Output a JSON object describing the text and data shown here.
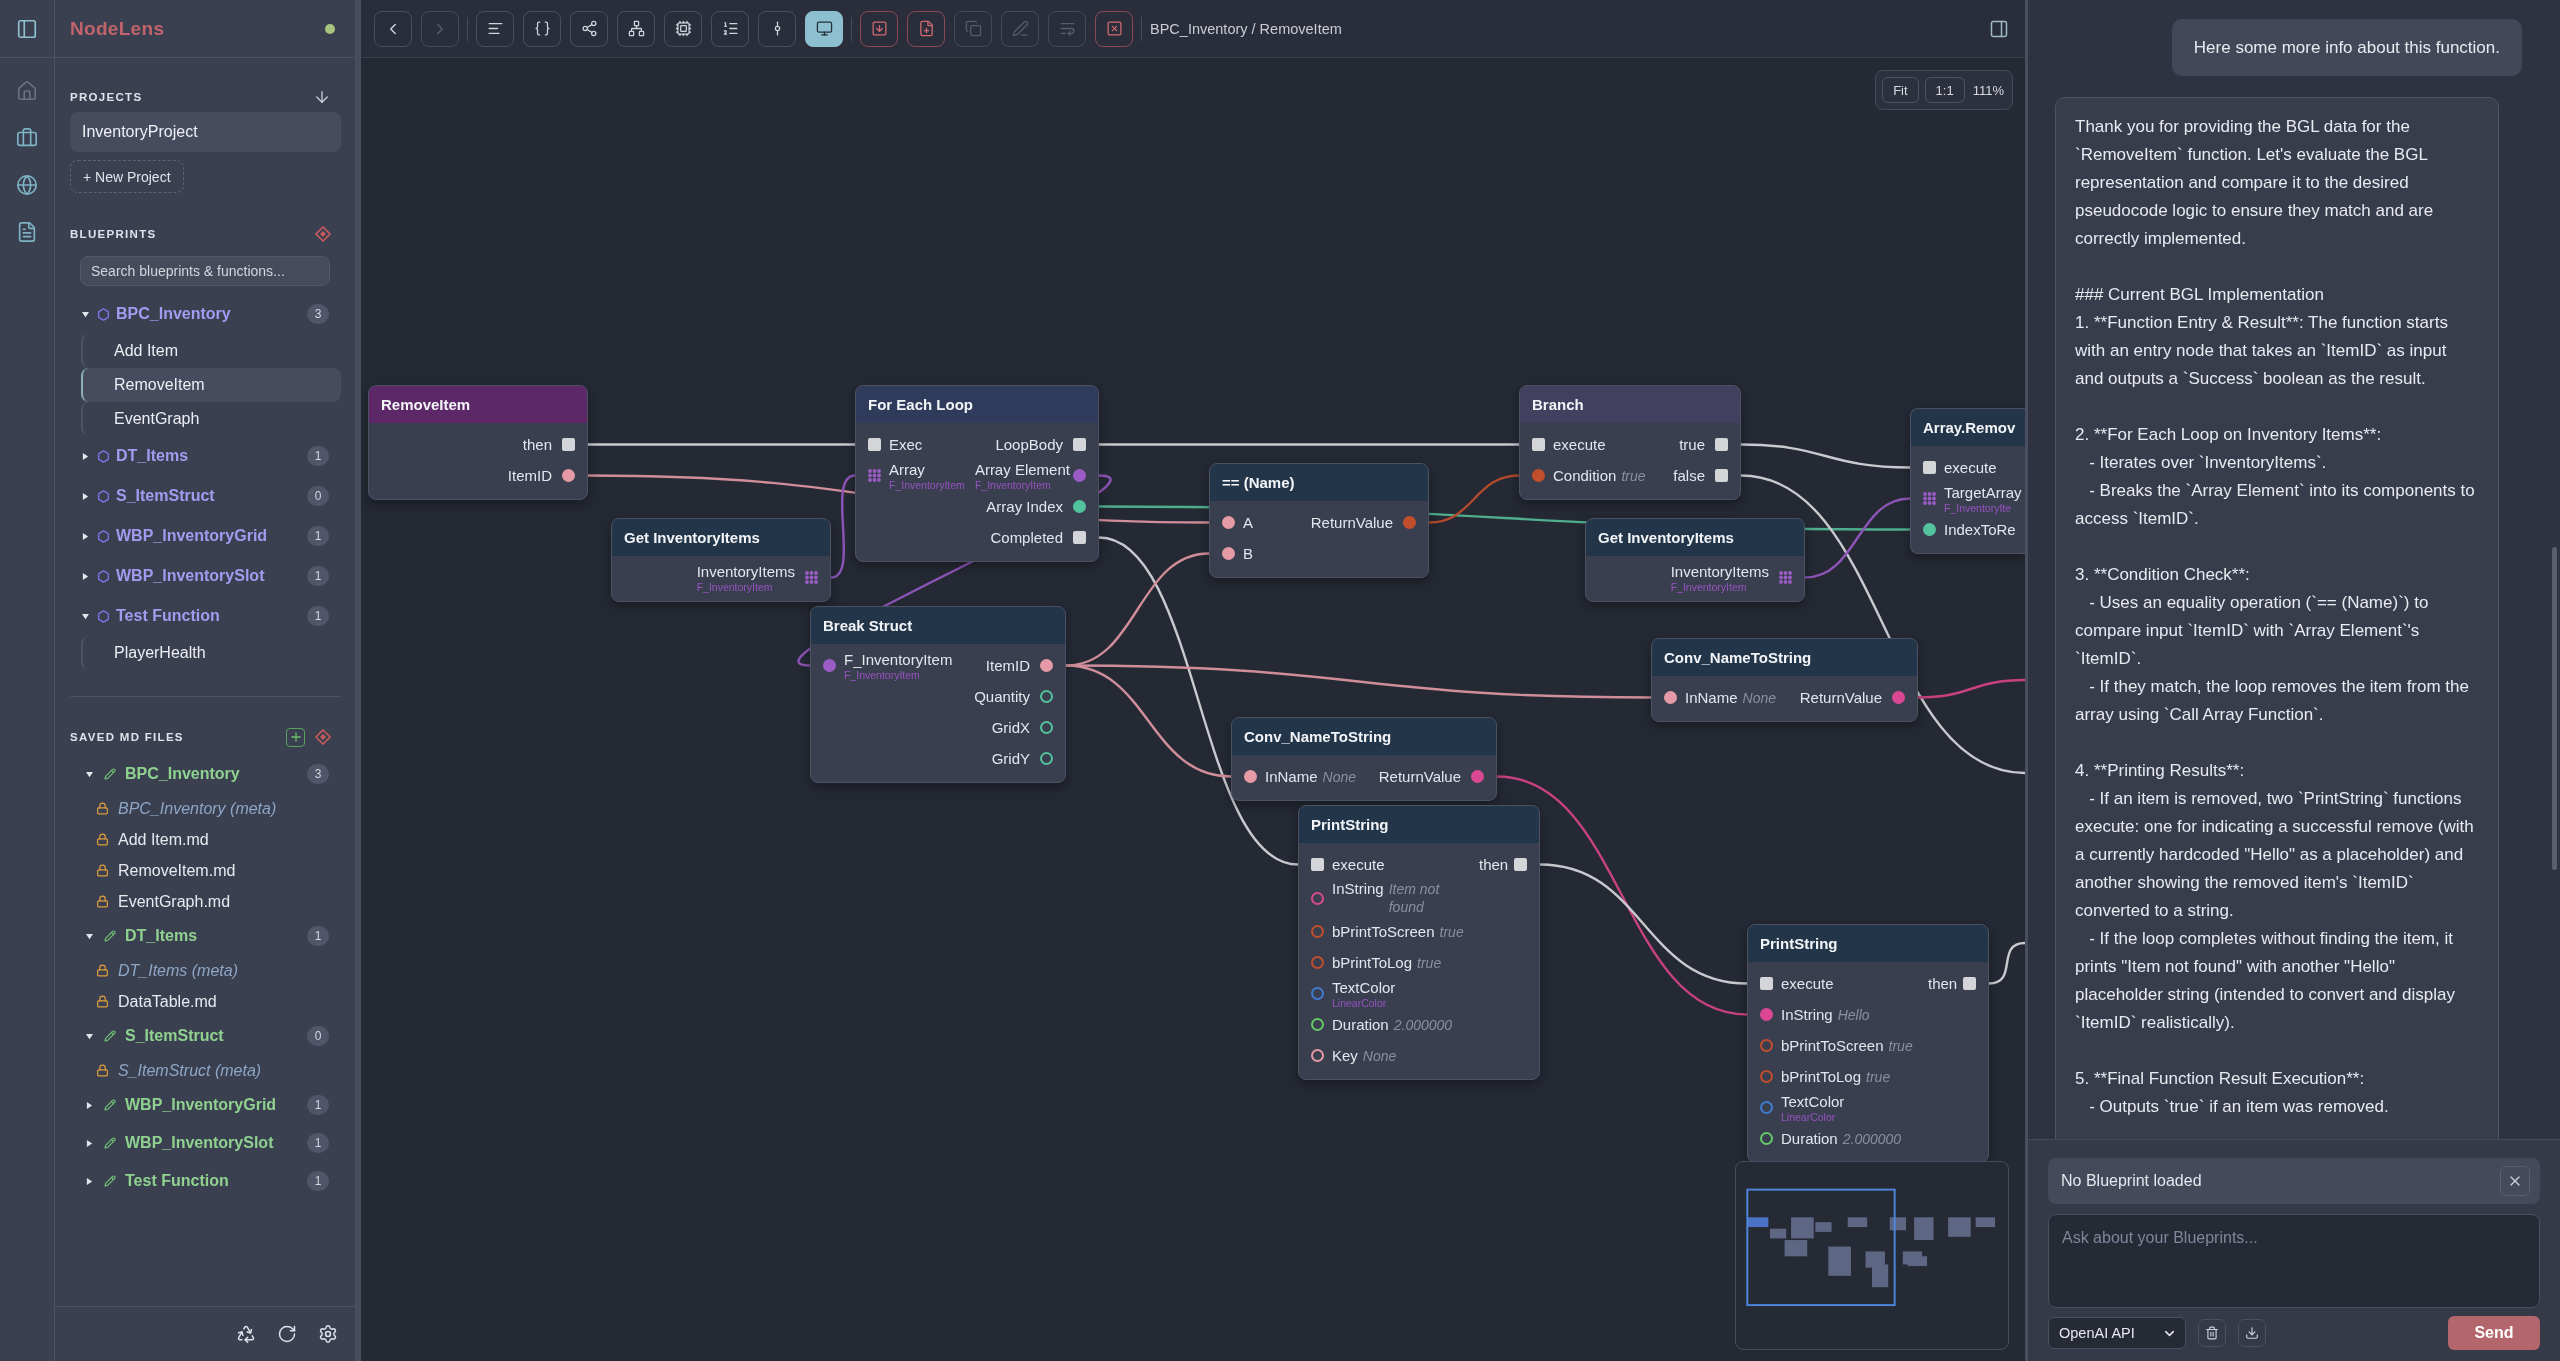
{
  "rail": {
    "items": [
      {
        "disabled": true
      },
      {
        "disabled": false
      },
      {
        "disabled": false
      },
      {
        "disabled": false
      }
    ]
  },
  "sidebar": {
    "brand": "NodeLens",
    "projects": {
      "title": "PROJECTS",
      "items": [
        {
          "label": "InventoryProject",
          "selected": true
        }
      ],
      "new_button": "+ New Project"
    },
    "blueprints": {
      "title": "BLUEPRINTS",
      "search": {
        "placeholder": "Search blueprints & functions..."
      },
      "items": [
        {
          "label": "BPC_Inventory",
          "count": "3",
          "expanded": true,
          "children": [
            {
              "label": "Add Item",
              "selected": false
            },
            {
              "label": "RemoveItem",
              "selected": true
            },
            {
              "label": "EventGraph",
              "selected": false
            }
          ]
        },
        {
          "label": "DT_Items",
          "count": "1",
          "expanded": false
        },
        {
          "label": "S_ItemStruct",
          "count": "0",
          "expanded": false
        },
        {
          "label": "WBP_InventoryGrid",
          "count": "1",
          "expanded": false
        },
        {
          "label": "WBP_InventorySlot",
          "count": "1",
          "expanded": false
        },
        {
          "label": "Test Function",
          "count": "1",
          "expanded": true,
          "children": [
            {
              "label": "PlayerHealth",
              "selected": false
            }
          ]
        }
      ]
    },
    "saved_files": {
      "title": "SAVED MD FILES",
      "groups": [
        {
          "label": "BPC_Inventory",
          "count": "3",
          "expanded": true,
          "children": [
            {
              "label": "BPC_Inventory (meta)",
              "kind": "meta"
            },
            {
              "label": "Add Item.md",
              "kind": "file"
            },
            {
              "label": "RemoveItem.md",
              "kind": "file"
            },
            {
              "label": "EventGraph.md",
              "kind": "file"
            }
          ]
        },
        {
          "label": "DT_Items",
          "count": "1",
          "expanded": true,
          "children": [
            {
              "label": "DT_Items (meta)",
              "kind": "meta"
            },
            {
              "label": "DataTable.md",
              "kind": "file"
            }
          ]
        },
        {
          "label": "S_ItemStruct",
          "count": "0",
          "expanded": true,
          "children": [
            {
              "label": "S_ItemStruct (meta)",
              "kind": "meta"
            }
          ]
        },
        {
          "label": "WBP_InventoryGrid",
          "count": "1",
          "expanded": false
        },
        {
          "label": "WBP_InventorySlot",
          "count": "1",
          "expanded": false
        },
        {
          "label": "Test Function",
          "count": "1",
          "expanded": false
        }
      ]
    }
  },
  "toolbar": {
    "nav": [
      {
        "disabled": false
      },
      {
        "disabled": true
      }
    ],
    "views": [
      {
        "selected": false
      },
      {
        "selected": false
      },
      {
        "selected": false
      },
      {
        "selected": false
      },
      {
        "selected": false
      },
      {
        "selected": false
      },
      {
        "selected": false
      },
      {
        "selected": true
      }
    ],
    "actions": [
      {
        "disabled": false
      },
      {
        "disabled": false
      },
      {
        "disabled": true
      },
      {
        "disabled": true
      },
      {
        "disabled": true
      },
      {
        "disabled": false
      }
    ],
    "breadcrumb": "BPC_Inventory / RemoveItem"
  },
  "canvas": {
    "zoom_controls": {
      "fit": "Fit",
      "actual_size": "1:1",
      "zoom": "111%"
    },
    "nodes": [
      {
        "title": "RemoveItem",
        "kind": "event",
        "outputs": [
          {
            "label": "then",
            "kind": "exec",
            "connected": true
          },
          {
            "label": "ItemID",
            "kind": "name",
            "connected": true
          }
        ]
      },
      {
        "title": "For Each Loop",
        "kind": "loop",
        "inputs": [
          {
            "label": "Exec",
            "kind": "exec",
            "connected": true
          },
          {
            "label": "Array",
            "kind": "array",
            "connected": true,
            "subtype": "F_InventoryItem"
          }
        ],
        "outputs": [
          {
            "label": "LoopBody",
            "kind": "exec",
            "connected": true
          },
          {
            "label": "Array Element",
            "kind": "struct",
            "connected": true,
            "subtype": "F_InventoryItem"
          },
          {
            "label": "Array Index",
            "kind": "int",
            "connected": true
          },
          {
            "label": "Completed",
            "kind": "exec",
            "connected": true
          }
        ]
      },
      {
        "title": "Branch",
        "kind": "branch",
        "inputs": [
          {
            "label": "execute",
            "kind": "exec",
            "connected": true
          },
          {
            "label": "Condition",
            "kind": "bool",
            "connected": true,
            "default": "true"
          }
        ],
        "outputs": [
          {
            "label": "true",
            "kind": "exec",
            "connected": true
          },
          {
            "label": "false",
            "kind": "exec",
            "connected": true
          }
        ]
      },
      {
        "title": "Array.Remov",
        "kind": "function",
        "inputs": [
          {
            "label": "execute",
            "kind": "exec",
            "connected": true
          },
          {
            "label": "TargetArray",
            "kind": "array",
            "connected": true,
            "subtype": "F_InventoryIte"
          },
          {
            "label": "IndexToRe",
            "kind": "int",
            "connected": true
          }
        ]
      },
      {
        "title": "== (Name)",
        "kind": "pure",
        "inputs": [
          {
            "label": "A",
            "kind": "name",
            "connected": true
          },
          {
            "label": "B",
            "kind": "name",
            "connected": true
          }
        ],
        "outputs": [
          {
            "label": "ReturnValue",
            "kind": "bool",
            "connected": true
          }
        ]
      },
      {
        "title": "Get InventoryItems",
        "kind": "pure",
        "outputs": [
          {
            "label": "InventoryItems",
            "kind": "array",
            "connected": true,
            "subtype": "F_InventoryItem"
          }
        ]
      },
      {
        "title": "Get InventoryItems",
        "kind": "pure",
        "outputs": [
          {
            "label": "InventoryItems",
            "kind": "array",
            "connected": true,
            "subtype": "F_InventoryItem"
          }
        ]
      },
      {
        "title": "Break Struct",
        "kind": "pure",
        "inputs": [
          {
            "label": "F_InventoryItem",
            "kind": "struct",
            "connected": true,
            "subtype": "F_InventoryItem"
          }
        ],
        "outputs": [
          {
            "label": "ItemID",
            "kind": "name",
            "connected": true
          },
          {
            "label": "Quantity",
            "kind": "int",
            "connected": false
          },
          {
            "label": "GridX",
            "kind": "int",
            "connected": false
          },
          {
            "label": "GridY",
            "kind": "int",
            "connected": false
          }
        ]
      },
      {
        "title": "Conv_NameToString",
        "kind": "pure",
        "inputs": [
          {
            "label": "InName",
            "kind": "name",
            "connected": true,
            "default": "None"
          }
        ],
        "outputs": [
          {
            "label": "ReturnValue",
            "kind": "string",
            "connected": true
          }
        ]
      },
      {
        "title": "Conv_NameToString",
        "kind": "pure",
        "inputs": [
          {
            "label": "InName",
            "kind": "name",
            "connected": true,
            "default": "None"
          }
        ],
        "outputs": [
          {
            "label": "ReturnValue",
            "kind": "string",
            "connected": true
          }
        ]
      },
      {
        "title": "PrintString",
        "kind": "function",
        "inputs": [
          {
            "label": "execute",
            "kind": "exec",
            "connected": true
          },
          {
            "label": "InString",
            "kind": "string",
            "connected": false,
            "default": "Item not found"
          },
          {
            "label": "bPrintToScreen",
            "kind": "bool",
            "connected": false,
            "default": "true"
          },
          {
            "label": "bPrintToLog",
            "kind": "bool",
            "connected": false,
            "default": "true"
          },
          {
            "label": "TextColor",
            "kind": "color",
            "connected": false,
            "subtype": "LinearColor"
          },
          {
            "label": "Duration",
            "kind": "float",
            "connected": false,
            "default": "2.000000"
          },
          {
            "label": "Key",
            "kind": "name",
            "connected": false,
            "default": "None"
          }
        ],
        "outputs": [
          {
            "label": "then",
            "kind": "exec",
            "connected": true
          }
        ]
      },
      {
        "title": "PrintString",
        "kind": "function",
        "inputs": [
          {
            "label": "execute",
            "kind": "exec",
            "connected": true
          },
          {
            "label": "InString",
            "kind": "string",
            "connected": true,
            "default": "Hello"
          },
          {
            "label": "bPrintToScreen",
            "kind": "bool",
            "connected": false,
            "default": "true"
          },
          {
            "label": "bPrintToLog",
            "kind": "bool",
            "connected": false,
            "default": "true"
          },
          {
            "label": "TextColor",
            "kind": "color",
            "connected": false,
            "subtype": "LinearColor"
          },
          {
            "label": "Duration",
            "kind": "float",
            "connected": false,
            "default": "2.000000"
          }
        ],
        "outputs": [
          {
            "label": "then",
            "kind": "exec",
            "connected": true
          }
        ]
      }
    ]
  },
  "chat": {
    "messages": [
      {
        "kind": "user",
        "paragraphs": [
          "Here some more info about this function."
        ]
      },
      {
        "kind": "assistant",
        "paragraphs": [
          "Thank you for providing the BGL data for the `RemoveItem` function. Let's evaluate the BGL representation and compare it to the desired pseudocode logic to ensure they match and are correctly implemented.",
          "### Current BGL Implementation\n1. **Function Entry & Result**: The function starts with an entry node that takes an `ItemID` as input and outputs a `Success` boolean as the result.",
          "2. **For Each Loop on Inventory Items**:\n   - Iterates over `InventoryItems`.\n   - Breaks the `Array Element` into its components to access `ItemID`.",
          "3. **Condition Check**:\n   - Uses an equality operation (`== (Name)`) to compare input `ItemID` with `Array Element`'s `ItemID`.\n   - If they match, the loop removes the item from the array using `Call Array Function`.",
          "4. **Printing Results**:\n   - If an item is removed, two `PrintString` functions execute: one for indicating a successful remove (with a currently hardcoded \"Hello\" as a placeholder) and another showing the removed item's `ItemID` converted to a string.\n   - If the loop completes without finding the item, it prints \"Item not found\" with another \"Hello\" placeholder string (intended to convert and display `ItemID` realistically).",
          "5. **Final Function Result Execution**:\n   - Outputs `true` if an item was removed."
        ]
      }
    ],
    "context": {
      "label": "No Blueprint loaded"
    },
    "input": {
      "placeholder": "Ask about your Blueprints..."
    },
    "provider": "OpenAI API",
    "send": "Send"
  }
}
